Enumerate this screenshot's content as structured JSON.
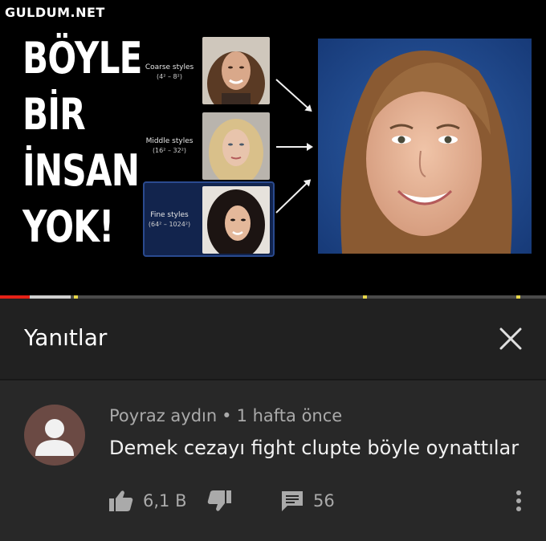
{
  "watermark": "GULDUM.NET",
  "video": {
    "title_lines": [
      "BÖYLE",
      "BİR",
      "İNSAN",
      "YOK!"
    ],
    "styles": [
      {
        "label": "Coarse styles",
        "range": "(4² – 8²)"
      },
      {
        "label": "Middle styles",
        "range": "(16² – 32²)"
      },
      {
        "label": "Fine styles",
        "range": "(64² – 1024²)"
      }
    ],
    "progress": {
      "played_fraction": 0.055,
      "buffered_fraction": 0.13
    }
  },
  "replies": {
    "title": "Yanıtlar",
    "close_icon": "close-icon"
  },
  "comment": {
    "author": "Poyraz aydın",
    "separator": "•",
    "time": "1 hafta önce",
    "text": "Demek cezayı fight clupte böyle oynattılar",
    "likes": "6,1 B",
    "replies_count": "56",
    "icons": [
      "avatar-icon",
      "thumbs-up-icon",
      "thumbs-down-icon",
      "comment-icon",
      "more-vertical-icon"
    ]
  },
  "colors": {
    "background": "#212121",
    "comment_background": "#282828",
    "progress_played": "#e62117",
    "secondary_text": "#aaaaaa"
  }
}
